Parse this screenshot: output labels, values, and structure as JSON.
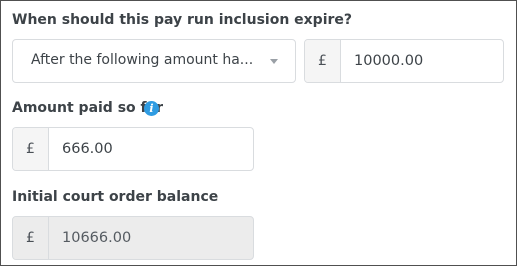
{
  "expiry": {
    "label": "When should this pay run inclusion expire?",
    "select_value": "After the following amount ha...",
    "currency_symbol": "£",
    "amount_value": "10000.00"
  },
  "paid_so_far": {
    "label": "Amount paid so far",
    "info_icon": "i",
    "currency_symbol": "£",
    "amount_value": "666.00"
  },
  "initial_balance": {
    "label": "Initial court order balance",
    "currency_symbol": "£",
    "amount_value": "10666.00"
  },
  "colors": {
    "info_icon": "#2f9ce2",
    "border": "#d9dcdf",
    "disabled_bg": "#ececec"
  }
}
